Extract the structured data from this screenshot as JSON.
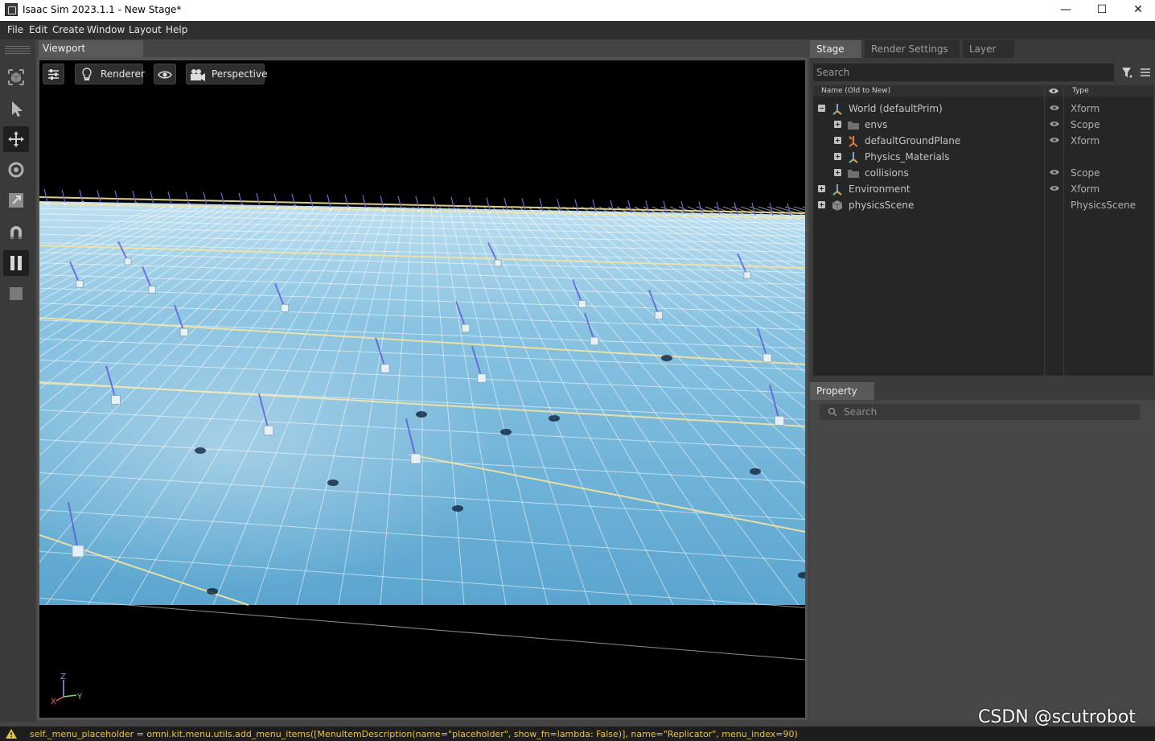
{
  "window": {
    "title": "Isaac Sim 2023.1.1 - New Stage*",
    "controls": [
      "minimize",
      "maximize",
      "close"
    ]
  },
  "menu": [
    "File",
    "Edit",
    "Create",
    "Window",
    "Layout",
    "Help"
  ],
  "left_toolbar": {
    "tools": [
      "cube-icon",
      "select-arrow-icon",
      "move-icon",
      "rotate-icon",
      "scale-icon",
      "snap-magnet-icon",
      "pause-icon",
      "stop-icon"
    ],
    "active_tool": "move-icon"
  },
  "viewport": {
    "tab_label": "Viewport",
    "buttons": {
      "settings": "settings-icon",
      "renderer": "Renderer",
      "visibility": "eye-icon",
      "camera": "Perspective"
    },
    "axes": {
      "z": "Z",
      "x": "X",
      "y": "Y"
    }
  },
  "stage_panel": {
    "tabs": [
      "Stage",
      "Render Settings",
      "Layer"
    ],
    "active_tab": "Stage",
    "search_placeholder": "Search",
    "columns": {
      "name": "Name (Old to New)",
      "type": "Type"
    },
    "rows": [
      {
        "name": "World (defaultPrim)",
        "type": "Xform",
        "icon": "xform-icon",
        "expanded": true,
        "depth": 0,
        "visible": true
      },
      {
        "name": "envs",
        "type": "Scope",
        "icon": "folder-icon",
        "expanded": false,
        "depth": 1,
        "visible": true
      },
      {
        "name": "defaultGroundPlane",
        "type": "Xform",
        "icon": "xform-ref-icon",
        "expanded": false,
        "depth": 1,
        "visible": true
      },
      {
        "name": "Physics_Materials",
        "type": "",
        "icon": "xform-icon",
        "expanded": false,
        "depth": 1,
        "visible": false
      },
      {
        "name": "collisions",
        "type": "Scope",
        "icon": "folder-icon",
        "expanded": false,
        "depth": 1,
        "visible": true
      },
      {
        "name": "Environment",
        "type": "Xform",
        "icon": "xform-icon",
        "expanded": false,
        "depth": 0,
        "visible": true
      },
      {
        "name": "physicsScene",
        "type": "PhysicsScene",
        "icon": "cube-prim-icon",
        "expanded": false,
        "depth": 0,
        "visible": false
      }
    ]
  },
  "property_panel": {
    "tab_label": "Property",
    "search_placeholder": "Search"
  },
  "status": {
    "message": "self._menu_placeholder = omni.kit.menu.utils.add_menu_items([MenuItemDescription(name=\"placeholder\", show_fn=lambda: False)], name=\"Replicator\", menu_index=90)"
  },
  "watermark": "CSDN @scutrobot"
}
